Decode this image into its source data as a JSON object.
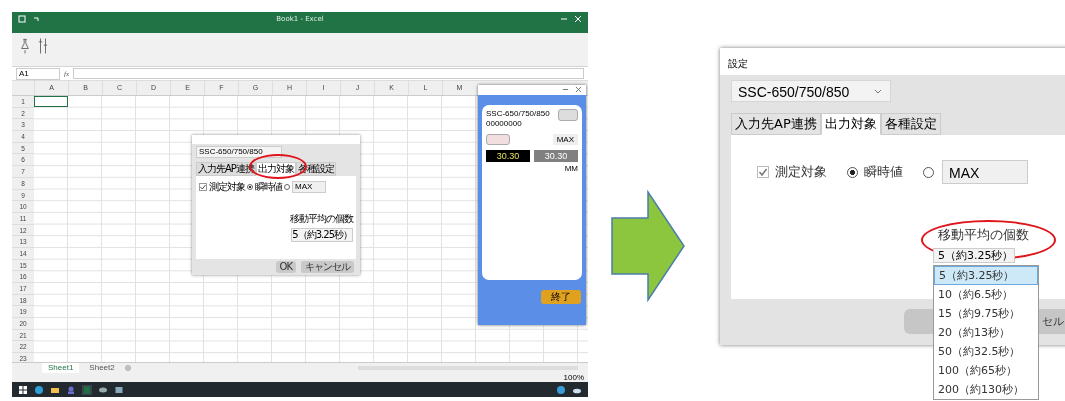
{
  "excel": {
    "title": "Book1 - Excel",
    "name_box": "A1",
    "formula_icon": "fx",
    "columns": [
      "A",
      "B",
      "C",
      "D",
      "E",
      "F",
      "G",
      "H",
      "I",
      "J",
      "K",
      "L",
      "M"
    ],
    "rows": [
      "1",
      "2",
      "3",
      "4",
      "5",
      "6",
      "7",
      "8",
      "9",
      "10",
      "11",
      "12",
      "13",
      "14",
      "15",
      "16",
      "17",
      "18",
      "19",
      "20",
      "21",
      "22",
      "23"
    ],
    "sheets": [
      {
        "label": "Sheet1",
        "selected": true
      },
      {
        "label": "Sheet2",
        "selected": false
      }
    ],
    "zoom": "100%",
    "mini_dialog": {
      "device": "SSC-650/750/850",
      "tabs": [
        {
          "label": "入力先AP連携",
          "selected": false
        },
        {
          "label": "出力対象",
          "selected": true
        },
        {
          "label": "各種設定",
          "selected": false
        }
      ],
      "checkbox": {
        "label": "測定対象",
        "checked": true
      },
      "radio": {
        "label": "瞬時値",
        "selected": true
      },
      "radio_max_selected": false,
      "max_value": "MAX",
      "avg_label": "移動平均の個数",
      "avg_value": "5（約3.25秒）",
      "ok": "OK",
      "cancel": "キャンセル"
    },
    "monitor": {
      "device": "SSC-650/750/850",
      "serial": "00000000",
      "mode": "MAX",
      "live": "30.30",
      "held": "30.30",
      "unit": "MM",
      "exit": "終了"
    }
  },
  "dialog": {
    "title": "設定",
    "device": "SSC-650/750/850",
    "tabs": [
      {
        "label": "入力先AP連携",
        "selected": false
      },
      {
        "label": "出力対象",
        "selected": true
      },
      {
        "label": "各種設定",
        "selected": false
      }
    ],
    "checkbox": {
      "label": "測定対象",
      "checked": true
    },
    "radios": [
      {
        "label": "瞬時値",
        "selected": true
      },
      {
        "selected": false
      }
    ],
    "max_value": "MAX",
    "avg_label": "移動平均の個数",
    "avg_value": "5（約3.25秒）",
    "options": [
      {
        "label": "5（約3.25秒）",
        "selected": true
      },
      {
        "label": "10（約6.5秒）",
        "selected": false
      },
      {
        "label": "15（約9.75秒）",
        "selected": false
      },
      {
        "label": "20（約13秒）",
        "selected": false
      },
      {
        "label": "50（約32.5秒）",
        "selected": false
      },
      {
        "label": "100（約65秒）",
        "selected": false
      },
      {
        "label": "200（約130秒）",
        "selected": false
      }
    ],
    "cancel_visible": "セル"
  }
}
